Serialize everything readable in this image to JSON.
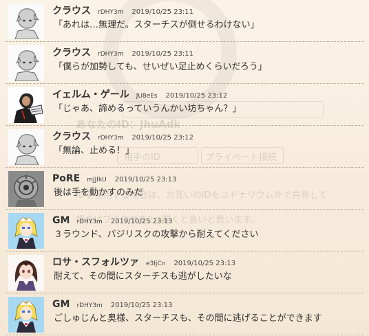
{
  "background": {
    "ghost_id": "あなたのID：JhuAdk",
    "ghost_peer": "相手のID",
    "ghost_private": "プライベート接続",
    "ghost_note1": "IDを使用する場合は、お互いのIDをユドナリウム外で共有して",
    "ghost_note2": "場合はブラウザを2つ開くと良いと思います。"
  },
  "messages": [
    {
      "name": "クラウス",
      "trip": "rDHY3m",
      "time": "2019/10/25 23:11",
      "text": "「あれは…無理だ。スターチスが倒せるわけない」",
      "avatar": "grey-knight-icon"
    },
    {
      "name": "クラウス",
      "trip": "rDHY3m",
      "time": "2019/10/25 23:11",
      "text": "「僕らが加勢しても、せいぜい足止めくらいだろう」",
      "avatar": "grey-knight-icon"
    },
    {
      "name": "イェルム・ゲール",
      "trip": "JU8eEs",
      "time": "2019/10/25 23:12",
      "text": "「じゃあ、諦めるっていうんかい坊ちゃん？」",
      "avatar": "dark-warrior-icon"
    },
    {
      "name": "クラウス",
      "trip": "rDHY3m",
      "time": "2019/10/25 23:12",
      "text": "「無論、止める！」",
      "avatar": "grey-knight-icon"
    },
    {
      "name": "PoRE",
      "trip": "mJJIkU",
      "time": "2019/10/25 23:13",
      "text": "後は手を動かすのみだ",
      "avatar": "grey-mask-icon"
    },
    {
      "name": "GM",
      "trip": "rDHY3m",
      "time": "2019/10/25 23:13",
      "text": "３ラウンド、バジリスクの攻撃から耐えてください",
      "avatar": "blonde-maid-icon"
    },
    {
      "name": "ロサ・スフォルツァ",
      "trip": "e3IjCn",
      "time": "2019/10/25 23:13",
      "text": "耐えて、その間にスターチスも逃がしたいな",
      "avatar": "brunette-girl-icon"
    },
    {
      "name": "GM",
      "trip": "rDHY3m",
      "time": "2019/10/25 23:13",
      "text": "ごしゅじんと奥様、スターチスも、その間に逃げることができます",
      "avatar": "blonde-maid-icon"
    }
  ]
}
